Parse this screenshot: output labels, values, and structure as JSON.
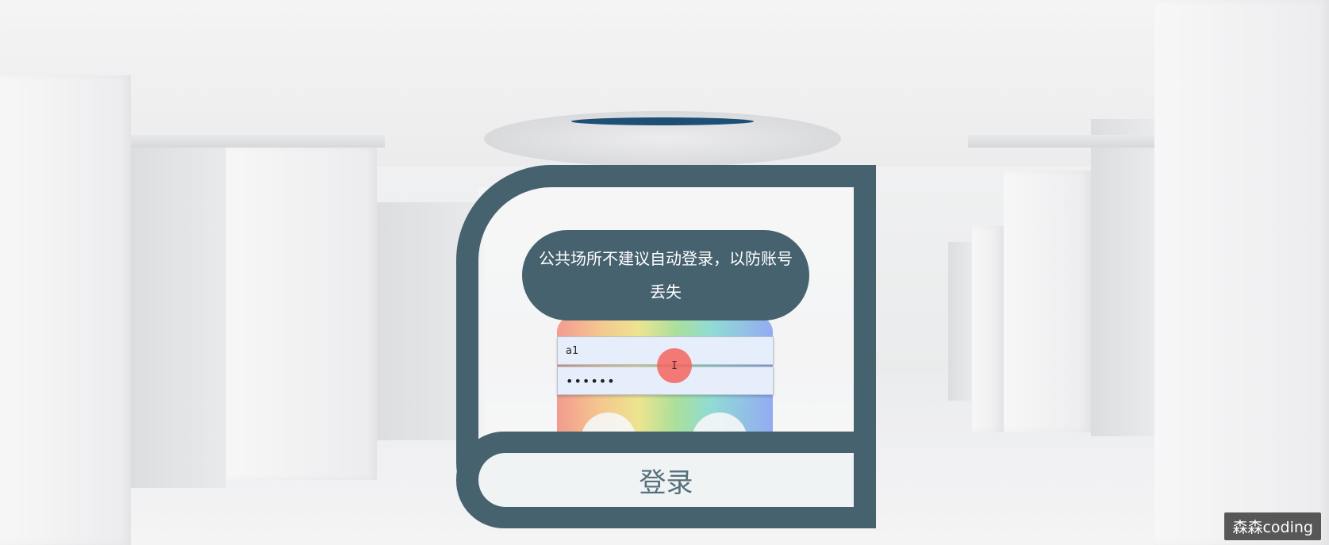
{
  "login": {
    "tip_text": "公共场所不建议自动登录，以防账号丢失",
    "username_value": "a1",
    "password_value": "••••••",
    "submit_label": "登录"
  },
  "cursor": {
    "glyph": "I"
  },
  "watermark": {
    "text": "森森coding"
  },
  "colors": {
    "card_frame": "#47626f",
    "input_bg": "#e7eefb",
    "cursor_highlight": "#f5645f",
    "ceiling_light": "#1e4f74"
  }
}
